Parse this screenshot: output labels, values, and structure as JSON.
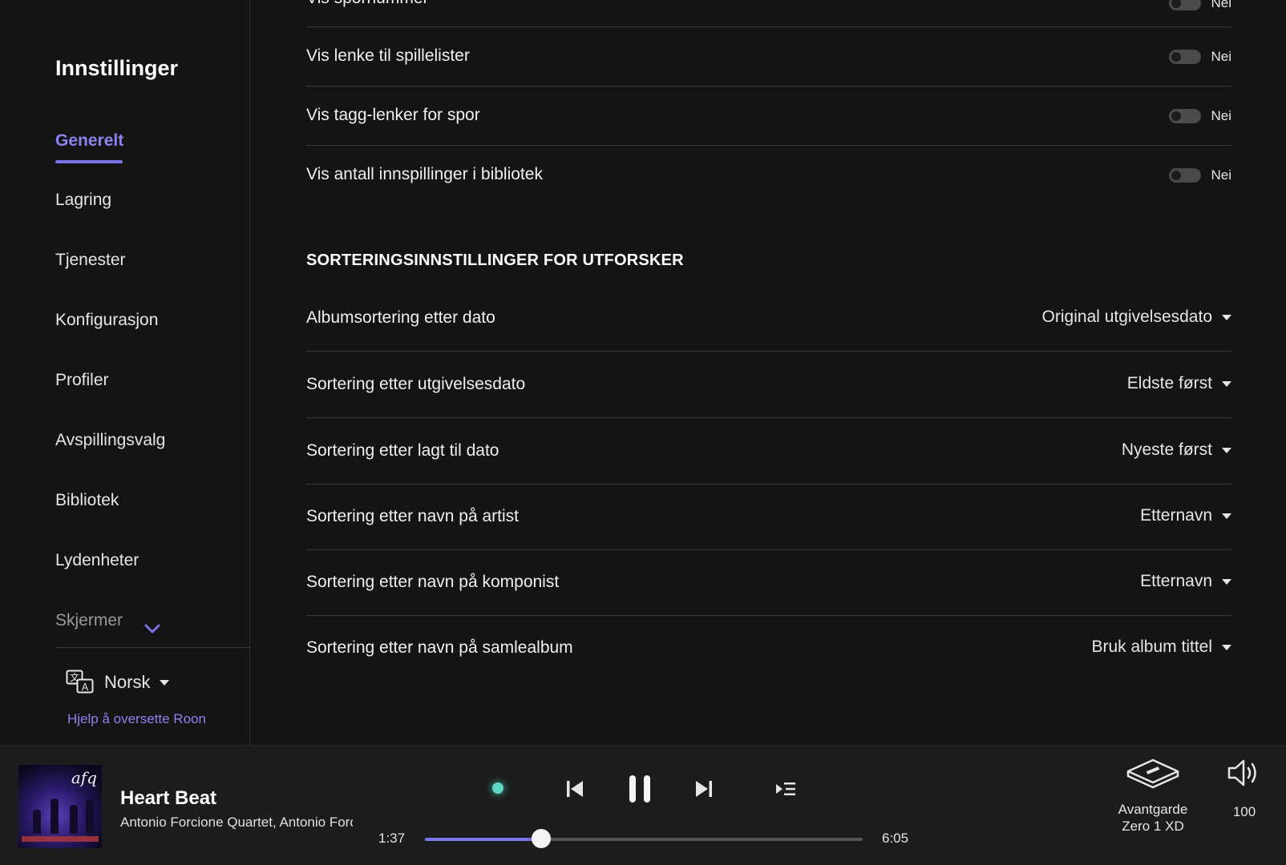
{
  "sidebar": {
    "title": "Innstillinger",
    "items": [
      {
        "label": "Generelt",
        "active": true
      },
      {
        "label": "Lagring"
      },
      {
        "label": "Tjenester"
      },
      {
        "label": "Konfigurasjon"
      },
      {
        "label": "Profiler"
      },
      {
        "label": "Avspillingsvalg"
      },
      {
        "label": "Bibliotek"
      },
      {
        "label": "Lydenheter"
      },
      {
        "label": "Skjermer"
      }
    ],
    "language": "Norsk",
    "help_link": "Hjelp å oversette Roon"
  },
  "main": {
    "toggles": [
      {
        "label": "Vis spornummer",
        "value": "Nei"
      },
      {
        "label": "Vis lenke til spillelister",
        "value": "Nei"
      },
      {
        "label": "Vis tagg-lenker for spor",
        "value": "Nei"
      },
      {
        "label": "Vis antall innspillinger i bibliotek",
        "value": "Nei"
      }
    ],
    "section_title": "SORTERINGSINNSTILLINGER FOR UTFORSKER",
    "selects": [
      {
        "label": "Albumsortering etter dato",
        "value": "Original utgivelsesdato"
      },
      {
        "label": "Sortering etter utgivelsesdato",
        "value": "Eldste først"
      },
      {
        "label": "Sortering etter lagt til dato",
        "value": "Nyeste først"
      },
      {
        "label": "Sortering etter navn på artist",
        "value": "Etternavn"
      },
      {
        "label": "Sortering etter navn på komponist",
        "value": "Etternavn"
      },
      {
        "label": "Sortering etter navn på samlealbum",
        "value": "Bruk album tittel"
      }
    ]
  },
  "player": {
    "track_title": "Heart Beat",
    "track_artist": "Antonio Forcione Quartet, Antonio Forcione",
    "album_art_text": "afq",
    "elapsed": "1:37",
    "duration": "6:05",
    "progress": 0.266,
    "zone_name": "Avantgarde Zero 1 XD",
    "volume": "100"
  },
  "colors": {
    "accent": "#7b74e6",
    "background": "#141414",
    "player_bg": "#1c1c1c",
    "signal_dot": "#5fd6c4"
  }
}
